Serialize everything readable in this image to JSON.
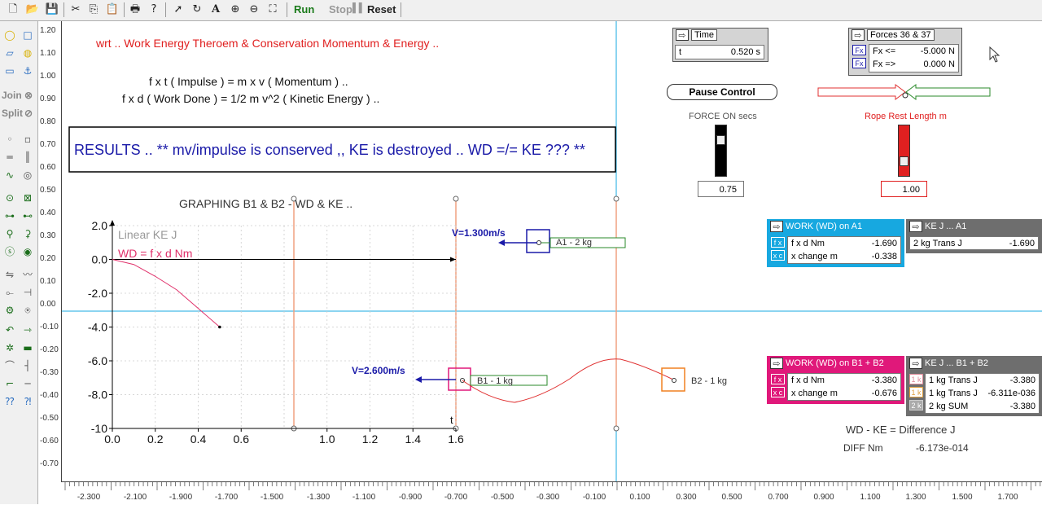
{
  "toolbar": {
    "icons": [
      "new-file-icon",
      "open-folder-icon",
      "save-icon",
      "cut-icon",
      "copy-icon",
      "paste-icon",
      "print-icon",
      "help-icon",
      "pointer-icon",
      "rotate-icon",
      "text-tool-icon",
      "zoom-in-icon",
      "zoom-out-icon",
      "zoom-fit-icon"
    ],
    "run_label": "Run",
    "stop_label": "Stop",
    "reset_label": "Reset"
  },
  "palette": {
    "join_label": "Join",
    "split_label": "Split"
  },
  "vruler": {
    "labels": [
      "1.20",
      "1.10",
      "1.00",
      "0.90",
      "0.80",
      "0.70",
      "0.60",
      "0.50",
      "0.40",
      "0.30",
      "0.20",
      "0.10",
      "0.00",
      "-0.10",
      "-0.20",
      "-0.30",
      "-0.40",
      "-0.50",
      "-0.60",
      "-0.70"
    ]
  },
  "hruler": {
    "labels": [
      "-2.300",
      "-2.100",
      "-1.900",
      "-1.700",
      "-1.500",
      "-1.300",
      "-1.100",
      "-0.900",
      "-0.700",
      "-0.500",
      "-0.300",
      "-0.100",
      "0.100",
      "0.300",
      "0.500",
      "0.700",
      "0.900",
      "1.100",
      "1.300",
      "1.500",
      "1.700"
    ]
  },
  "canvas": {
    "title": "wrt .. Work Energy Theroem & Conservation Momentum & Energy ..",
    "eq1": "f x t  (  Impulse  )  =  m x v  (  Momentum  )  ..",
    "eq2": "f x d  (  Work Done  )  =  1/2 m v^2  (  Kinetic Energy  )  ..",
    "results": "RESULTS .. ** mv/impulse is conserved ,, KE is destroyed .. WD =/= KE ??? **",
    "graph_title": "GRAPHING B1 & B2 - WD & KE ..",
    "legend_ke": "Linear KE J",
    "legend_wd": "WD = f x d Nm",
    "t_label": "t",
    "v_a1": "V=1.300m/s",
    "v_b1": "V=2.600m/s",
    "a1_label": "A1 - 2 kg",
    "b1_label": "B1 - 1 kg",
    "b2_label": "B2 - 1 kg",
    "diff_title": "WD  -  KE  =  Difference  J",
    "diff_label": "DIFF Nm",
    "diff_value": "-6.173e-014"
  },
  "chart_data": {
    "type": "line",
    "x_ticks": [
      "0.0",
      "0.2",
      "0.4",
      "0.6",
      "1.0",
      "1.2",
      "1.4",
      "1.6"
    ],
    "y_ticks": [
      "2.0",
      "0.0",
      "-2.0",
      "-4.0",
      "-6.0",
      "-8.0",
      "-10"
    ],
    "xlim": [
      0,
      1.6
    ],
    "ylim": [
      -10,
      2
    ],
    "series": [
      {
        "name": "Linear KE J",
        "color": "#999999",
        "x": [
          0.0,
          1.6
        ],
        "y": [
          0.0,
          0.0
        ]
      },
      {
        "name": "WD = f x d Nm",
        "color": "#e0306a",
        "x": [
          0.0,
          0.1,
          0.2,
          0.3,
          0.4,
          0.5
        ],
        "y": [
          0.0,
          -0.3,
          -1.0,
          -1.8,
          -2.9,
          -4.0
        ]
      }
    ]
  },
  "time_panel": {
    "title": "Time",
    "label": "t",
    "value": "0.520 s"
  },
  "forces_panel": {
    "title": "Forces 36 & 37",
    "row1_label": "Fx <=",
    "row1_value": "-5.000 N",
    "row2_label": "Fx =>",
    "row2_value": "0.000 N",
    "tag": "Fx"
  },
  "pause_label": "Pause Control",
  "force_on": {
    "label": "FORCE ON secs",
    "value": "0.75"
  },
  "rope": {
    "label": "Rope Rest Length m",
    "value": "1.00"
  },
  "work_a1": {
    "title": "WORK (WD) on A1",
    "row1_tag": "f x",
    "row1_label": "f x d Nm",
    "row1_value": "-1.690",
    "row2_tag": "x c",
    "row2_label": "x change m",
    "row2_value": "-0.338"
  },
  "ke_a1": {
    "title": "KE J ... A1",
    "row1_label": "2 kg Trans J",
    "row1_value": "-1.690"
  },
  "work_b": {
    "title": "WORK (WD) on B1 + B2",
    "row1_tag": "f x",
    "row1_label": "f x d Nm",
    "row1_value": "-3.380",
    "row2_tag": "x c",
    "row2_label": "x change m",
    "row2_value": "-0.676"
  },
  "ke_b": {
    "title": "KE J ... B1 + B2",
    "row1_tag": "1 k",
    "row1_label": "1 kg Trans J",
    "row1_value": "-3.380",
    "row2_tag": "1 k",
    "row2_label": "1 kg Trans J",
    "row2_value": "-6.311e-036",
    "row3_tag": "2 k",
    "row3_label": "2 kg SUM",
    "row3_value": "-3.380"
  },
  "colors": {
    "cyan": "#17a8e0",
    "magenta": "#e0187a",
    "gray": "#6e6e6e",
    "blue": "#1a1aa8",
    "red": "#e02020",
    "green": "#2a8a2a",
    "orange": "#f08020"
  }
}
